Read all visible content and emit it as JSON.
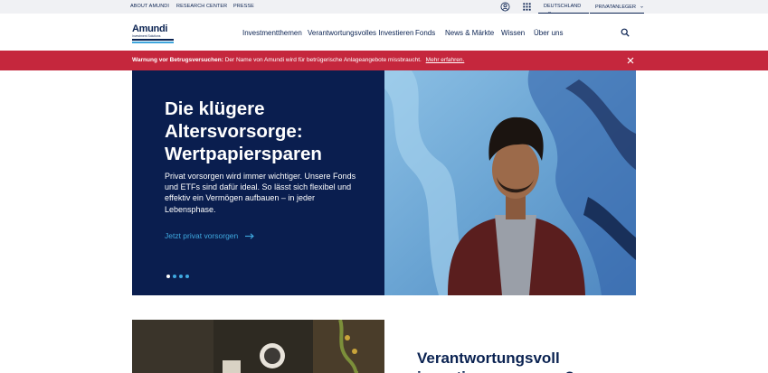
{
  "topbar": {
    "links": [
      "ABOUT AMUNDI",
      "RESEARCH CENTER",
      "PRESSE"
    ],
    "language": "DEUTSCHLAND",
    "audience": "PRIVATANLEGER"
  },
  "logo": {
    "name": "Amundi",
    "tagline": "Investment Solutions"
  },
  "nav": {
    "items": [
      "Investmentthemen",
      "Verantwortungsvolles Investieren",
      "Fonds",
      "News & Märkte",
      "Wissen",
      "Über uns"
    ]
  },
  "warning": {
    "label": "Warnung vor Betrugsversuchen:",
    "text": "Der Name von Amundi wird für betrügerische Anlageangebote missbraucht.",
    "link": "Mehr erfahren."
  },
  "hero": {
    "title": "Die klügere Altersvorsorge: Wertpapiersparen",
    "body": "Privat vorsorgen wird immer wichtiger. Unsere Fonds und ETFs sind dafür ideal. So lässt sich flexibel und effektiv ein Vermögen aufbauen – in jeder Lebensphase.",
    "cta": "Jetzt privat vorsorgen",
    "slides_total": 4,
    "slide_active": 1
  },
  "section2": {
    "title": "Verantwortungsvoll investieren – warum?"
  },
  "colors": {
    "navy": "#0a2251",
    "hero_bg": "#0a1e4f",
    "accent_blue": "#3fa9e0",
    "warning_red": "#c5273d",
    "topbar_bg": "#f0f1f4"
  },
  "icons": {
    "account": "user-circle-icon",
    "apps": "grid-icon",
    "search": "search-icon",
    "close": "close-icon",
    "cta_arrow": "arrow-right-icon",
    "dropdown": "chevron-down-icon"
  }
}
